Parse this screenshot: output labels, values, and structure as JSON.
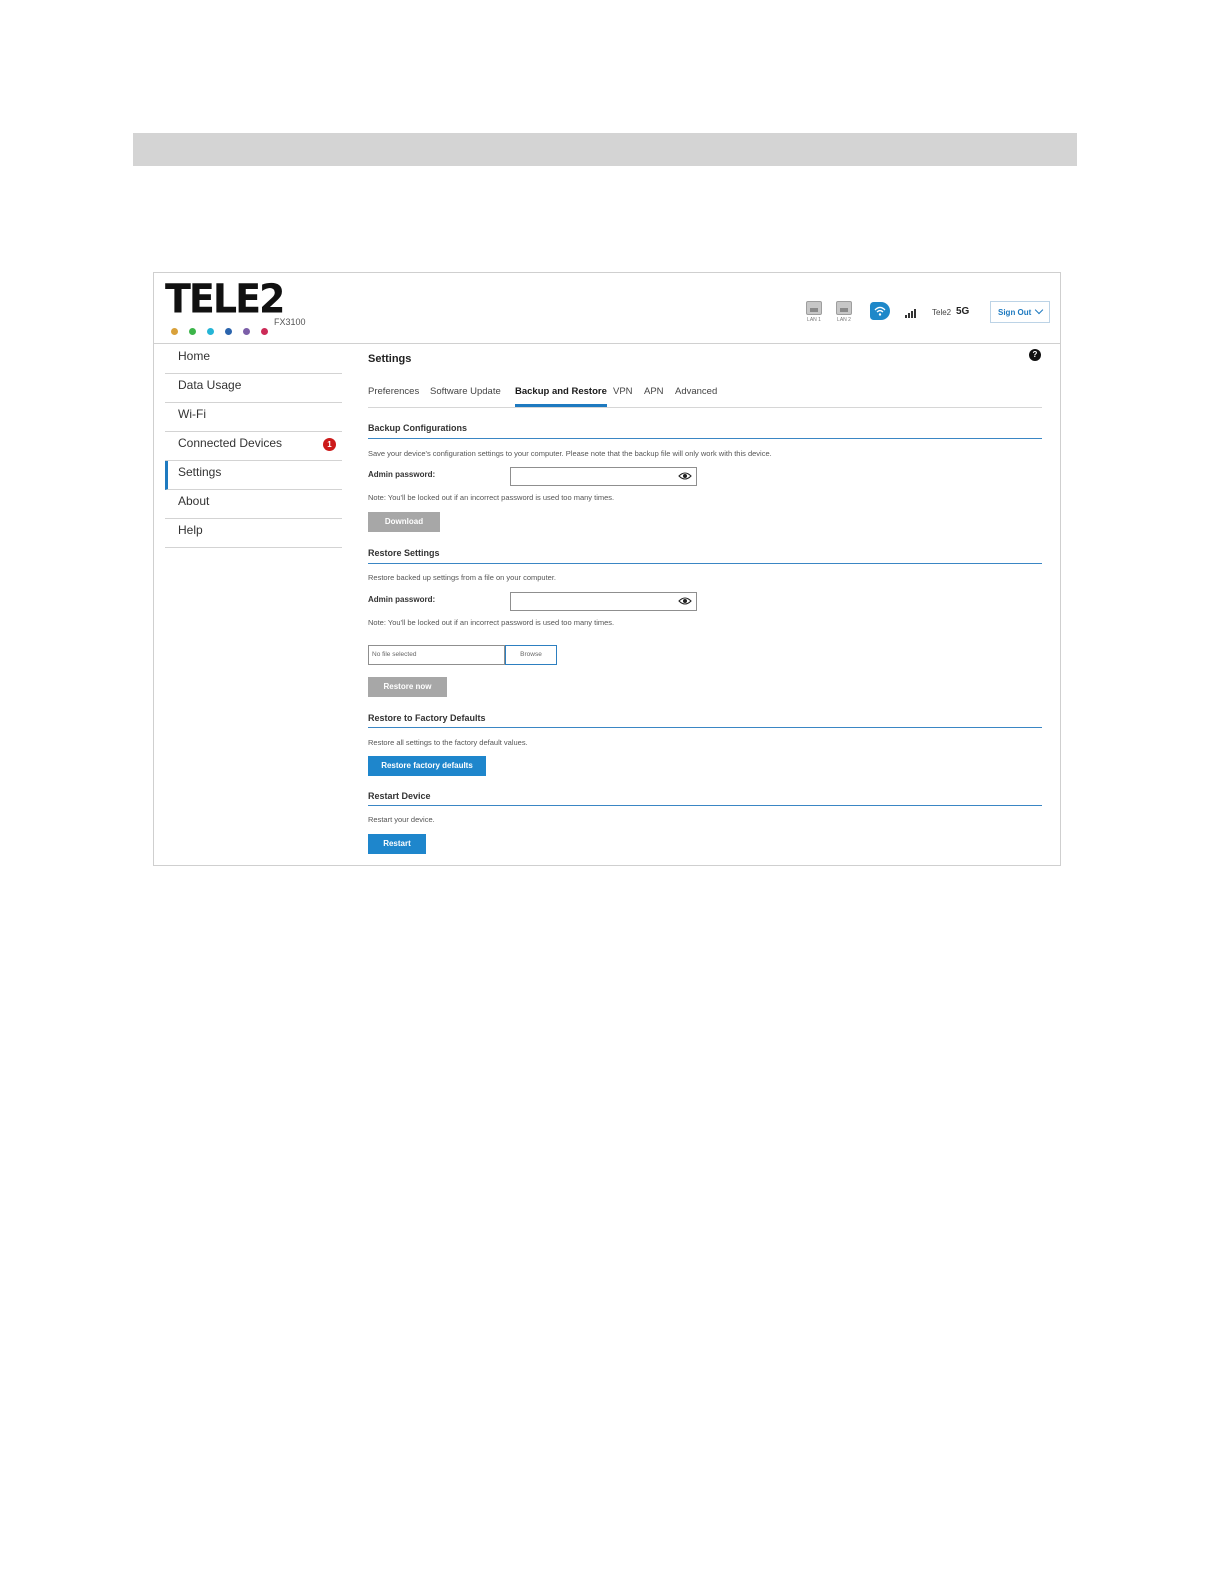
{
  "app": {
    "brand": "TELE2",
    "model": "FX3100",
    "brand_dot_colors": [
      "#d9a13a",
      "#3cb54a",
      "#25b5d6",
      "#2a64ad",
      "#7b5ea8",
      "#cc2a57"
    ]
  },
  "status_bar": {
    "lan1_label": "LAN 1",
    "lan2_label": "LAN 2",
    "carrier": "Tele2",
    "network_type": "5G",
    "sign_out_label": "Sign Out"
  },
  "sidebar": {
    "items": [
      {
        "label": "Home"
      },
      {
        "label": "Data Usage"
      },
      {
        "label": "Wi-Fi"
      },
      {
        "label": "Connected Devices",
        "badge": "1"
      },
      {
        "label": "Settings",
        "active": true
      },
      {
        "label": "About"
      },
      {
        "label": "Help"
      }
    ]
  },
  "main": {
    "title": "Settings",
    "help_glyph": "?",
    "tabs": [
      {
        "label": "Preferences"
      },
      {
        "label": "Software Update"
      },
      {
        "label": "Backup and Restore",
        "active": true
      },
      {
        "label": "VPN"
      },
      {
        "label": "APN"
      },
      {
        "label": "Advanced"
      }
    ],
    "backup": {
      "title": "Backup Configurations",
      "description": "Save your device's configuration settings to your computer. Please note that the backup file will only work with this device.",
      "password_label": "Admin password:",
      "password_value": "",
      "note": "Note: You'll be locked out if an incorrect password is used too many times.",
      "download_label": "Download"
    },
    "restore": {
      "title": "Restore Settings",
      "description": "Restore backed up settings from a file on your computer.",
      "password_label": "Admin password:",
      "password_value": "",
      "note": "Note: You'll be locked out if an incorrect password is used too many times.",
      "file_status": "No file selected",
      "browse_label": "Browse",
      "restore_label": "Restore now"
    },
    "factory": {
      "title": "Restore to Factory Defaults",
      "description": "Restore all settings to the factory default values.",
      "button_label": "Restore factory defaults"
    },
    "restart": {
      "title": "Restart Device",
      "description": "Restart your device.",
      "button_label": "Restart"
    }
  },
  "colors": {
    "accent": "#1e7ac0",
    "button_blue": "#1e86cc",
    "button_gray": "#a7a7a7",
    "badge_red": "#cc1a1a",
    "top_band": "#d4d4d4"
  }
}
